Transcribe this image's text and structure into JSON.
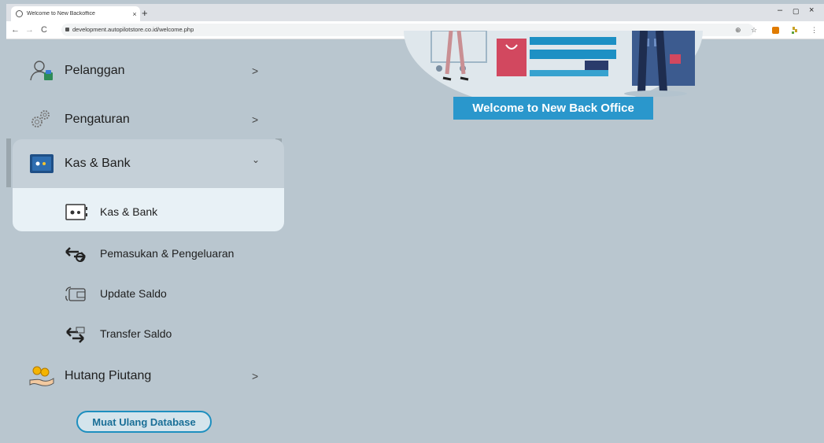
{
  "browser": {
    "tab_title": "Welcome to New Backoffice",
    "tab_close": "×",
    "new_tab": "+",
    "url": "development.autopilotstore.co.id/welcome.php",
    "back": "←",
    "forward": "→",
    "reload": "C",
    "zoom_icon": "⊕",
    "star_icon": "☆",
    "menu_icon": "⋮",
    "minimize": "–",
    "maximize": "▢",
    "close": "×"
  },
  "sidebar": {
    "items": [
      {
        "label": "Pelanggan",
        "chevron": ">",
        "icon": "customer-icon"
      },
      {
        "label": "Pengaturan",
        "chevron": ">",
        "icon": "settings-gears-icon"
      },
      {
        "label": "Kas & Bank",
        "chevron": "⌄",
        "icon": "safe-box-icon",
        "expanded": true
      },
      {
        "label": "Hutang Piutang",
        "chevron": ">",
        "icon": "debt-hand-icon"
      }
    ],
    "sub_items": [
      {
        "label": "Kas & Bank",
        "icon": "safe-icon",
        "active": true
      },
      {
        "label": "Pemasukan & Pengeluaran",
        "icon": "income-expense-icon"
      },
      {
        "label": "Update Saldo",
        "icon": "wallet-update-icon"
      },
      {
        "label": "Transfer Saldo",
        "icon": "transfer-money-icon"
      }
    ],
    "reload_button": "Muat Ulang Database"
  },
  "main": {
    "welcome_button": "Welcome to New Back Office"
  },
  "colors": {
    "accent": "#2a97cc",
    "background": "#b9c6cf",
    "active_bg": "#e8f1f6"
  }
}
